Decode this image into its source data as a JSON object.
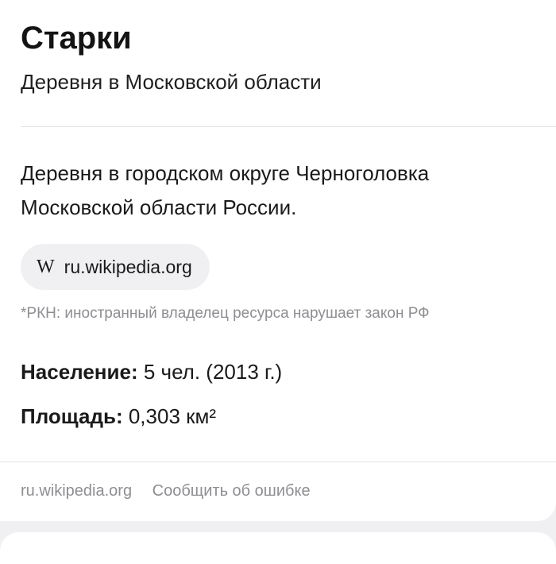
{
  "card": {
    "title": "Старки",
    "subtitle": "Деревня в Московской области",
    "description": "Деревня в городском округе Черноголовка Московской области России.",
    "source_chip": {
      "icon": "W",
      "label": "ru.wikipedia.org"
    },
    "rkn_note": "*РКН: иностранный владелец ресурса нарушает закон РФ",
    "facts": {
      "population": {
        "label": "Население:",
        "value": "5 чел. (2013 г.)"
      },
      "area": {
        "label": "Площадь:",
        "value": "0,303 км²"
      }
    },
    "footer": {
      "source_link": "ru.wikipedia.org",
      "report_link": "Сообщить об ошибке"
    }
  }
}
